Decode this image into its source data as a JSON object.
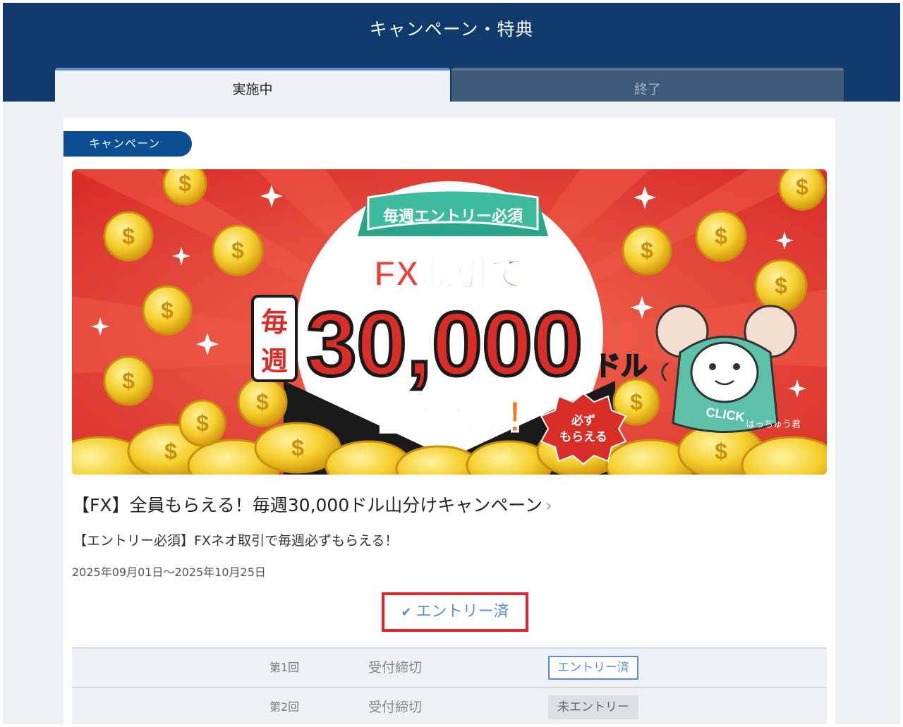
{
  "header": {
    "title": "キャンペーン・特典"
  },
  "tabs": [
    {
      "label": "実施中",
      "active": true
    },
    {
      "label": "終了",
      "active": false
    }
  ],
  "section_badge": "キャンペーン",
  "banner": {
    "ribbon": "毎週エントリー必須",
    "line1": "FX取引で",
    "weekly_top": "毎",
    "weekly_bottom": "週",
    "amount": "30,000",
    "unit": "ドル",
    "split": "山分け!",
    "stamp_top": "必ず",
    "stamp_bottom": "もらえる",
    "click": "CLICK",
    "mascot": "はっちゅう君"
  },
  "campaign": {
    "title": "【FX】全員もらえる！毎週30,000ドル山分けキャンペーン",
    "title_chevron": "›",
    "subtitle": "【エントリー必須】FXネオ取引で毎週必ずもらえる！",
    "period": "2025年09月01日〜2025年10月25日",
    "entry_status": "エントリー済"
  },
  "rounds": [
    {
      "round": "第1回",
      "status": "受付締切",
      "entry": "エントリー済",
      "entered": true
    },
    {
      "round": "第2回",
      "status": "受付締切",
      "entry": "未エントリー",
      "entered": false
    }
  ],
  "colors": {
    "header_bg": "#0f3a6b",
    "accent_blue": "#5b8fd0",
    "badge_blue": "#0d4d92",
    "highlight_red": "#e3262c",
    "banner_red": "#e8413a"
  }
}
